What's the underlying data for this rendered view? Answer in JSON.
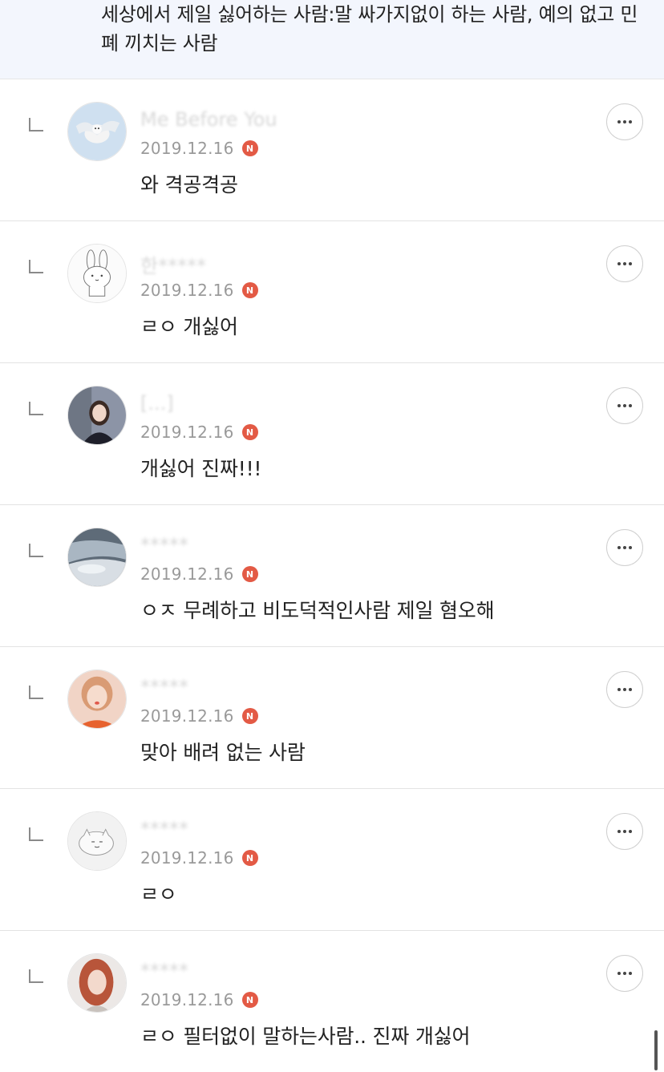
{
  "parent_comment": {
    "text": "세상에서 제일 싫어하는 사람:말 싸가지없이 하는 사람, 예의 없고 민폐 끼치는 사람"
  },
  "replies": [
    {
      "nickname": "Me Before You",
      "date": "2019.12.16",
      "badge": "N",
      "text": "와 격공격공",
      "avatar": "bird-avatar"
    },
    {
      "nickname": "한*****",
      "date": "2019.12.16",
      "badge": "N",
      "text": "ㄹㅇ 개싫어",
      "avatar": "rabbit-avatar"
    },
    {
      "nickname": "[...]",
      "date": "2019.12.16",
      "badge": "N",
      "text": "개싫어 진짜!!!",
      "avatar": "girl-avatar"
    },
    {
      "nickname": "*****",
      "date": "2019.12.16",
      "badge": "N",
      "text": "ㅇㅈ 무례하고 비도덕적인사람 제일 혐오해",
      "avatar": "sky-avatar"
    },
    {
      "nickname": "*****",
      "date": "2019.12.16",
      "badge": "N",
      "text": "맞아 배려 없는 사람",
      "avatar": "woman-avatar"
    },
    {
      "nickname": "*****",
      "date": "2019.12.16",
      "badge": "N",
      "text": "ㄹㅇ",
      "avatar": "cat-avatar"
    },
    {
      "nickname": "*****",
      "date": "2019.12.16",
      "badge": "N",
      "text": "ㄹㅇ 필터없이 말하는사람.. 진짜 개싫어",
      "avatar": "redhair-avatar"
    }
  ],
  "colors": {
    "parent_bg": "#f3f6fd",
    "badge": "#e35a45",
    "date": "#9a9a9a"
  },
  "icons": {
    "more": "more-dots-icon",
    "reply": "reply-arrow-icon",
    "badge": "new-badge-icon"
  }
}
